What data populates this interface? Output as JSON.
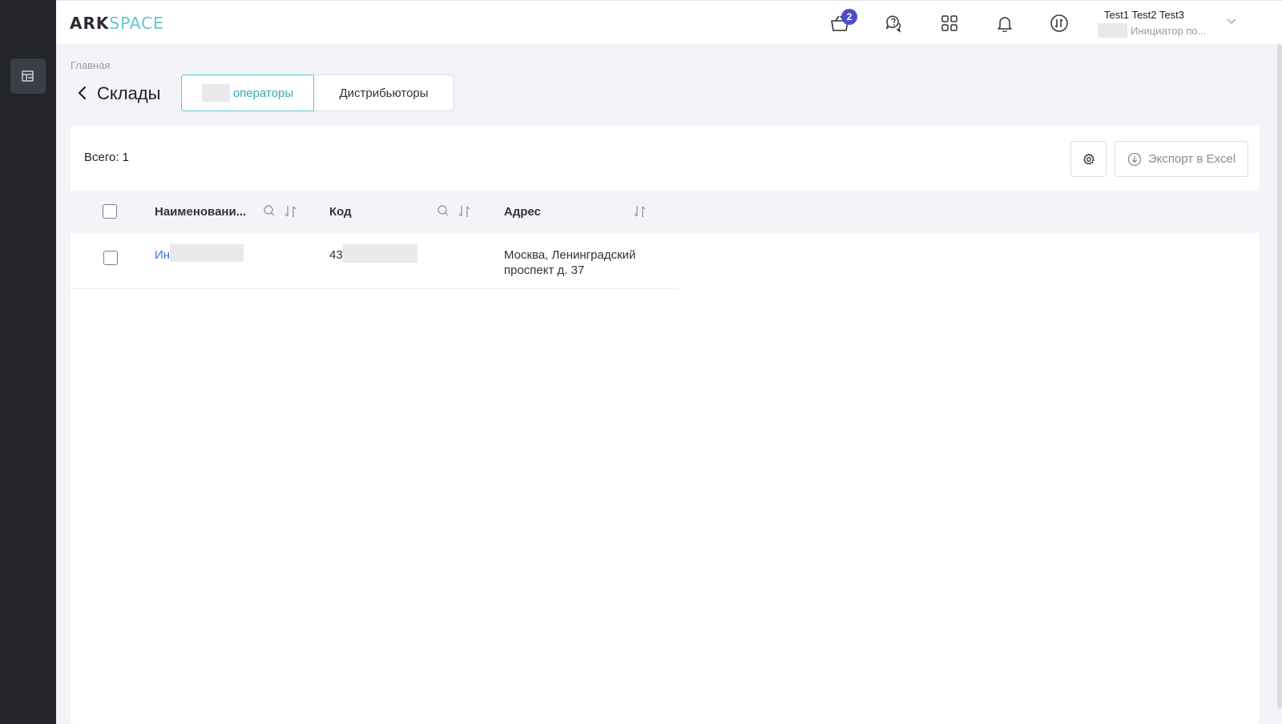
{
  "logo": {
    "part1": "ARK",
    "part2": "SPACE"
  },
  "sidebar": {
    "items": [
      {
        "icon": "table-icon"
      }
    ]
  },
  "header": {
    "cart_badge": "2",
    "icons": [
      "basket-icon",
      "help-chat-icon",
      "apps-grid-icon",
      "bell-icon",
      "sync-icon"
    ],
    "user": {
      "name": "Test1 Test2 Test3",
      "role": "Инициатор по..."
    }
  },
  "breadcrumb": "Главная",
  "page_title": "Склады",
  "tabs": [
    {
      "label": "операторы",
      "active": true
    },
    {
      "label": "Дистрибьюторы",
      "active": false
    }
  ],
  "toolbar": {
    "total": "Всего: 1",
    "export_label": "Экспорт в Excel"
  },
  "table": {
    "columns": [
      "Наименовани...",
      "Код",
      "Адрес"
    ],
    "rows": [
      {
        "name": "Ин",
        "code": "43",
        "address": "Москва, Ленинградский проспект д. 37"
      }
    ]
  },
  "colors": {
    "accent": "#5ec7cf",
    "link": "#3d74d6",
    "badge": "#4f4cc9",
    "rail": "#23252b"
  }
}
